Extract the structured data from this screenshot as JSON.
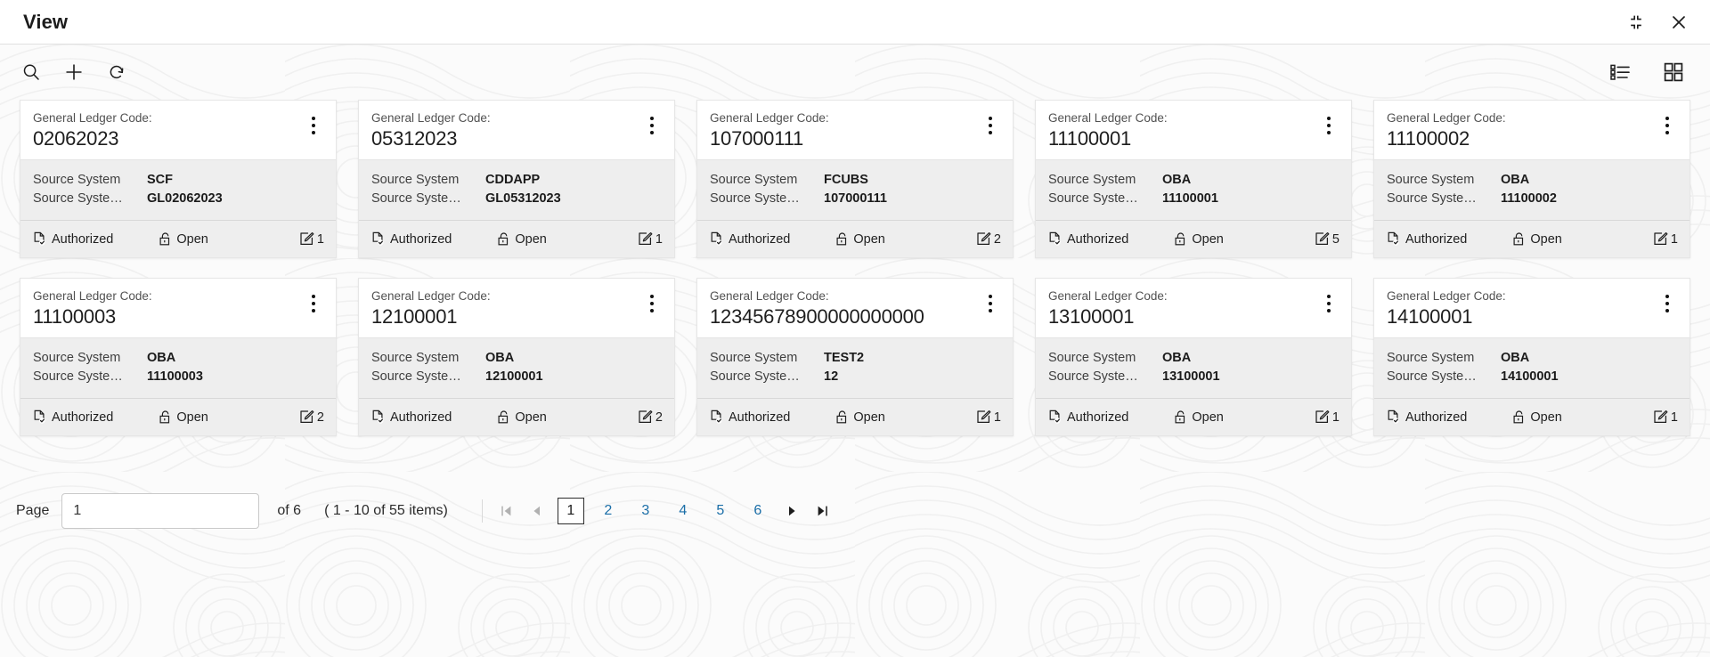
{
  "window": {
    "title": "View",
    "collapse_icon": "collapse-icon",
    "close_icon": "close-icon"
  },
  "toolbar": {
    "search_icon": "search-icon",
    "add_icon": "plus-icon",
    "refresh_icon": "refresh-icon",
    "list_view_icon": "list-view-icon",
    "grid_view_icon": "grid-view-icon"
  },
  "card_labels": {
    "title_label": "General Ledger Code:",
    "source_system_label": "Source System",
    "source_system_code_label": "Source Syste…",
    "status_icon": "authorized-document-icon",
    "lock_icon": "unlock-icon",
    "modification_icon": "edit-square-icon"
  },
  "cards": [
    {
      "gl_code": "02062023",
      "source_system": "SCF",
      "source_system_code": "GL02062023",
      "status": "Authorized",
      "lock_status": "Open",
      "mod_count": "1"
    },
    {
      "gl_code": "05312023",
      "source_system": "CDDAPP",
      "source_system_code": "GL05312023",
      "status": "Authorized",
      "lock_status": "Open",
      "mod_count": "1"
    },
    {
      "gl_code": "107000111",
      "source_system": "FCUBS",
      "source_system_code": "107000111",
      "status": "Authorized",
      "lock_status": "Open",
      "mod_count": "2"
    },
    {
      "gl_code": "11100001",
      "source_system": "OBA",
      "source_system_code": "11100001",
      "status": "Authorized",
      "lock_status": "Open",
      "mod_count": "5"
    },
    {
      "gl_code": "11100002",
      "source_system": "OBA",
      "source_system_code": "11100002",
      "status": "Authorized",
      "lock_status": "Open",
      "mod_count": "1"
    },
    {
      "gl_code": "11100003",
      "source_system": "OBA",
      "source_system_code": "11100003",
      "status": "Authorized",
      "lock_status": "Open",
      "mod_count": "2"
    },
    {
      "gl_code": "12100001",
      "source_system": "OBA",
      "source_system_code": "12100001",
      "status": "Authorized",
      "lock_status": "Open",
      "mod_count": "2"
    },
    {
      "gl_code": "12345678900000000000",
      "source_system": "TEST2",
      "source_system_code": "12",
      "status": "Authorized",
      "lock_status": "Open",
      "mod_count": "1"
    },
    {
      "gl_code": "13100001",
      "source_system": "OBA",
      "source_system_code": "13100001",
      "status": "Authorized",
      "lock_status": "Open",
      "mod_count": "1"
    },
    {
      "gl_code": "14100001",
      "source_system": "OBA",
      "source_system_code": "14100001",
      "status": "Authorized",
      "lock_status": "Open",
      "mod_count": "1"
    }
  ],
  "pagination": {
    "page_label": "Page",
    "page_value": "1",
    "of_text": "of 6",
    "range_text": "( 1 - 10 of 55 items)",
    "first_icon": "first-page-icon",
    "prev_icon": "previous-page-icon",
    "next_icon": "next-page-icon",
    "last_icon": "last-page-icon",
    "pages": [
      "1",
      "2",
      "3",
      "4",
      "5",
      "6"
    ],
    "current_page": "1",
    "link_color": "#1a6ea8"
  }
}
